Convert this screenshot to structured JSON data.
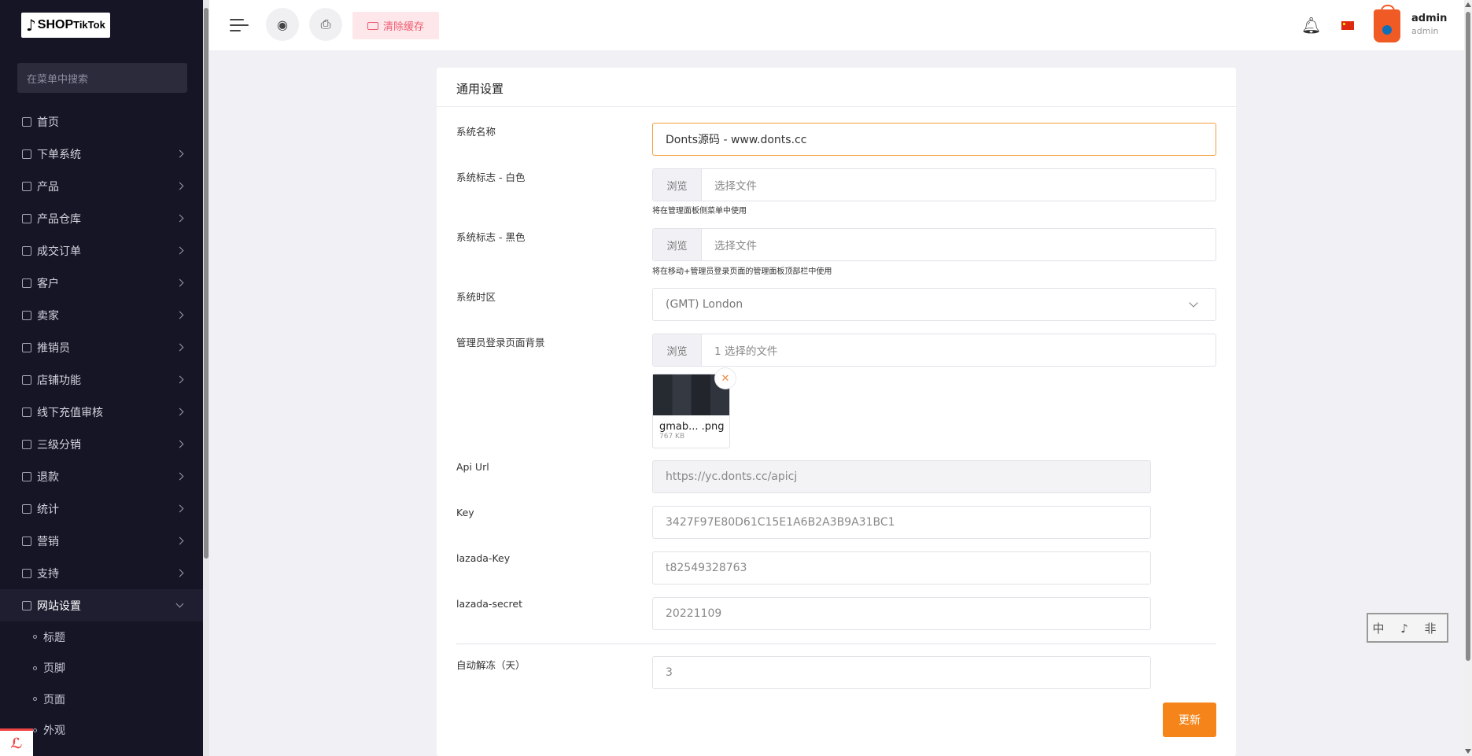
{
  "sidebar": {
    "logo_mark": "♪",
    "logo_text": "SHOP",
    "logo_text_small": "TikTok",
    "search_placeholder": "在菜单中搜索",
    "menu": [
      {
        "label": "首页",
        "icon": "home-icon",
        "has_chevron": false
      },
      {
        "label": "下单系统",
        "icon": "list-icon",
        "has_chevron": true
      },
      {
        "label": "产品",
        "icon": "cart-icon",
        "has_chevron": true
      },
      {
        "label": "产品仓库",
        "icon": "warehouse-icon",
        "has_chevron": true
      },
      {
        "label": "成交订单",
        "icon": "money-icon",
        "has_chevron": true
      },
      {
        "label": "客户",
        "icon": "users-icon",
        "has_chevron": true
      },
      {
        "label": "卖家",
        "icon": "user-icon",
        "has_chevron": true
      },
      {
        "label": "推销员",
        "icon": "user-icon",
        "has_chevron": true
      },
      {
        "label": "店铺功能",
        "icon": "user-icon",
        "has_chevron": true
      },
      {
        "label": "线下充值审核",
        "icon": "money-icon",
        "has_chevron": true
      },
      {
        "label": "三级分销",
        "icon": "link-icon",
        "has_chevron": true
      },
      {
        "label": "退款",
        "icon": "back-icon",
        "has_chevron": true
      },
      {
        "label": "统计",
        "icon": "file-icon",
        "has_chevron": true
      },
      {
        "label": "营销",
        "icon": "megaphone-icon",
        "has_chevron": true
      },
      {
        "label": "支持",
        "icon": "link-icon",
        "has_chevron": true
      },
      {
        "label": "网站设置",
        "icon": "monitor-icon",
        "has_chevron": true,
        "active": true
      }
    ],
    "submenu": [
      "标题",
      "页脚",
      "页面",
      "外观"
    ]
  },
  "header": {
    "clear_cache_label": "清除缓存",
    "user_name": "admin",
    "user_role": "admin"
  },
  "card": {
    "title": "通用设置",
    "fields": {
      "system_name": {
        "label": "系统名称",
        "value": "Donts源码 - www.donts.cc"
      },
      "logo_white": {
        "label": "系统标志 - 白色",
        "browse": "浏览",
        "file": "选择文件",
        "hint": "将在管理面板侧菜单中使用"
      },
      "logo_black": {
        "label": "系统标志 - 黑色",
        "browse": "浏览",
        "file": "选择文件",
        "hint": "将在移动+管理员登录页面的管理面板顶部栏中使用"
      },
      "timezone": {
        "label": "系统时区",
        "value": "(GMT) London"
      },
      "login_bg": {
        "label": "管理员登录页面背景",
        "browse": "浏览",
        "file": "1 选择的文件",
        "thumb_name": "gmab... .png",
        "thumb_size": "767 KB"
      },
      "api_url": {
        "label": "Api Url",
        "value": "https://yc.donts.cc/apicj"
      },
      "key": {
        "label": "Key",
        "value": "3427F97E80D61C15E1A6B2A3B9A31BC1"
      },
      "lazada_key": {
        "label": "lazada-Key",
        "value": "t82549328763"
      },
      "lazada_secret": {
        "label": "lazada-secret",
        "value": "20221109"
      },
      "auto_unfreeze": {
        "label": "自动解冻（天）",
        "value": "3"
      }
    },
    "update_label": "更新"
  },
  "stamp_text": "中 ♪ 非",
  "colors": {
    "accent": "#f5851b",
    "sidebar_bg": "#151525",
    "focus_border": "#f59f3a",
    "cache_bg": "#fde7ea"
  }
}
